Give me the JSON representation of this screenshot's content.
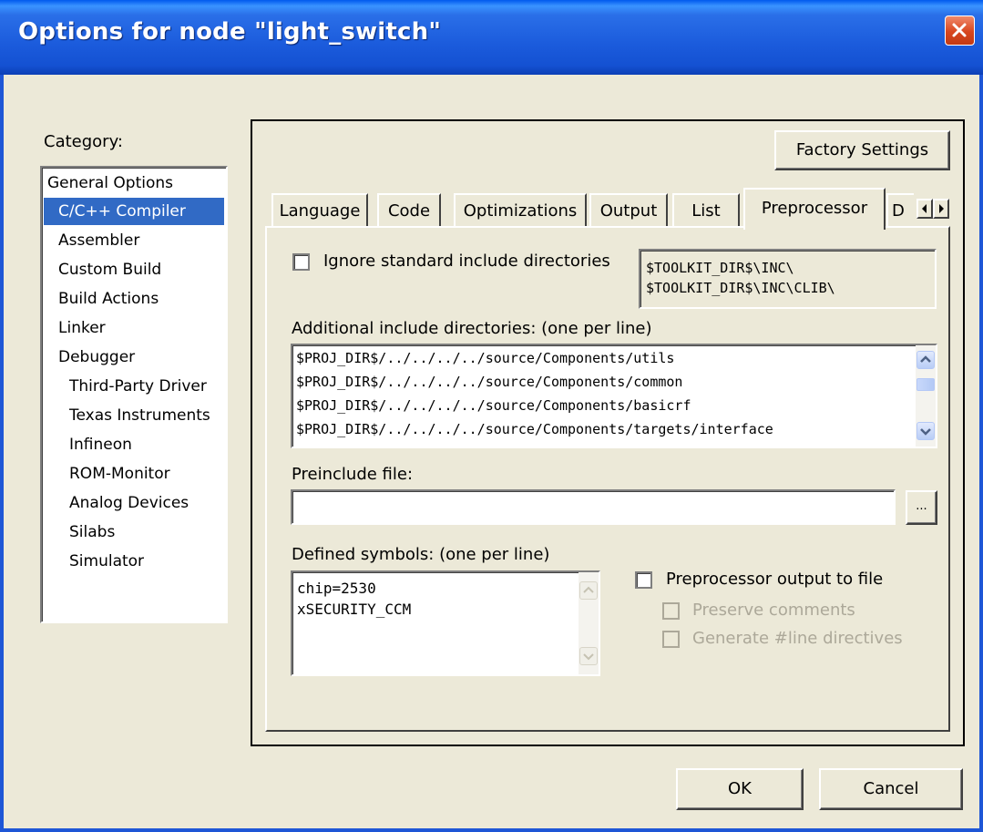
{
  "window": {
    "title": "Options for node \"light_switch\"",
    "close_icon": "close-icon"
  },
  "category": {
    "label": "Category:",
    "items": [
      "General Options",
      "C/C++ Compiler",
      "Assembler",
      "Custom Build",
      "Build Actions",
      "Linker",
      "Debugger",
      "Third-Party Driver",
      "Texas Instruments",
      "Infineon",
      "ROM-Monitor",
      "Analog Devices",
      "Silabs",
      "Simulator"
    ],
    "selected": "C/C++ Compiler"
  },
  "factory_settings_label": "Factory Settings",
  "tabs": [
    "Language",
    "Code",
    "Optimizations",
    "Output",
    "List",
    "Preprocessor",
    "D"
  ],
  "active_tab": "Preprocessor",
  "preprocessor": {
    "ignore_std_label": "Ignore standard include directories",
    "ignore_std_checked": false,
    "std_dirs": [
      "$TOOLKIT_DIR$\\INC\\",
      "$TOOLKIT_DIR$\\INC\\CLIB\\"
    ],
    "additional_label": "Additional include directories: (one per line)",
    "additional_dirs": [
      "$PROJ_DIR$/../../../../source/Components/utils",
      "$PROJ_DIR$/../../../../source/Components/common",
      "$PROJ_DIR$/../../../../source/Components/basicrf",
      "$PROJ_DIR$/../../../../source/Components/targets/interface"
    ],
    "preinclude_label": "Preinclude file:",
    "preinclude_value": "",
    "browse_label": "...",
    "defined_label": "Defined symbols: (one per line)",
    "defined_symbols": [
      "chip=2530",
      "xSECURITY_CCM"
    ],
    "output_to_file_label": "Preprocessor output to file",
    "output_to_file_checked": false,
    "preserve_comments_label": "Preserve comments",
    "generate_line_label": "Generate #line directives"
  },
  "buttons": {
    "ok": "OK",
    "cancel": "Cancel"
  }
}
